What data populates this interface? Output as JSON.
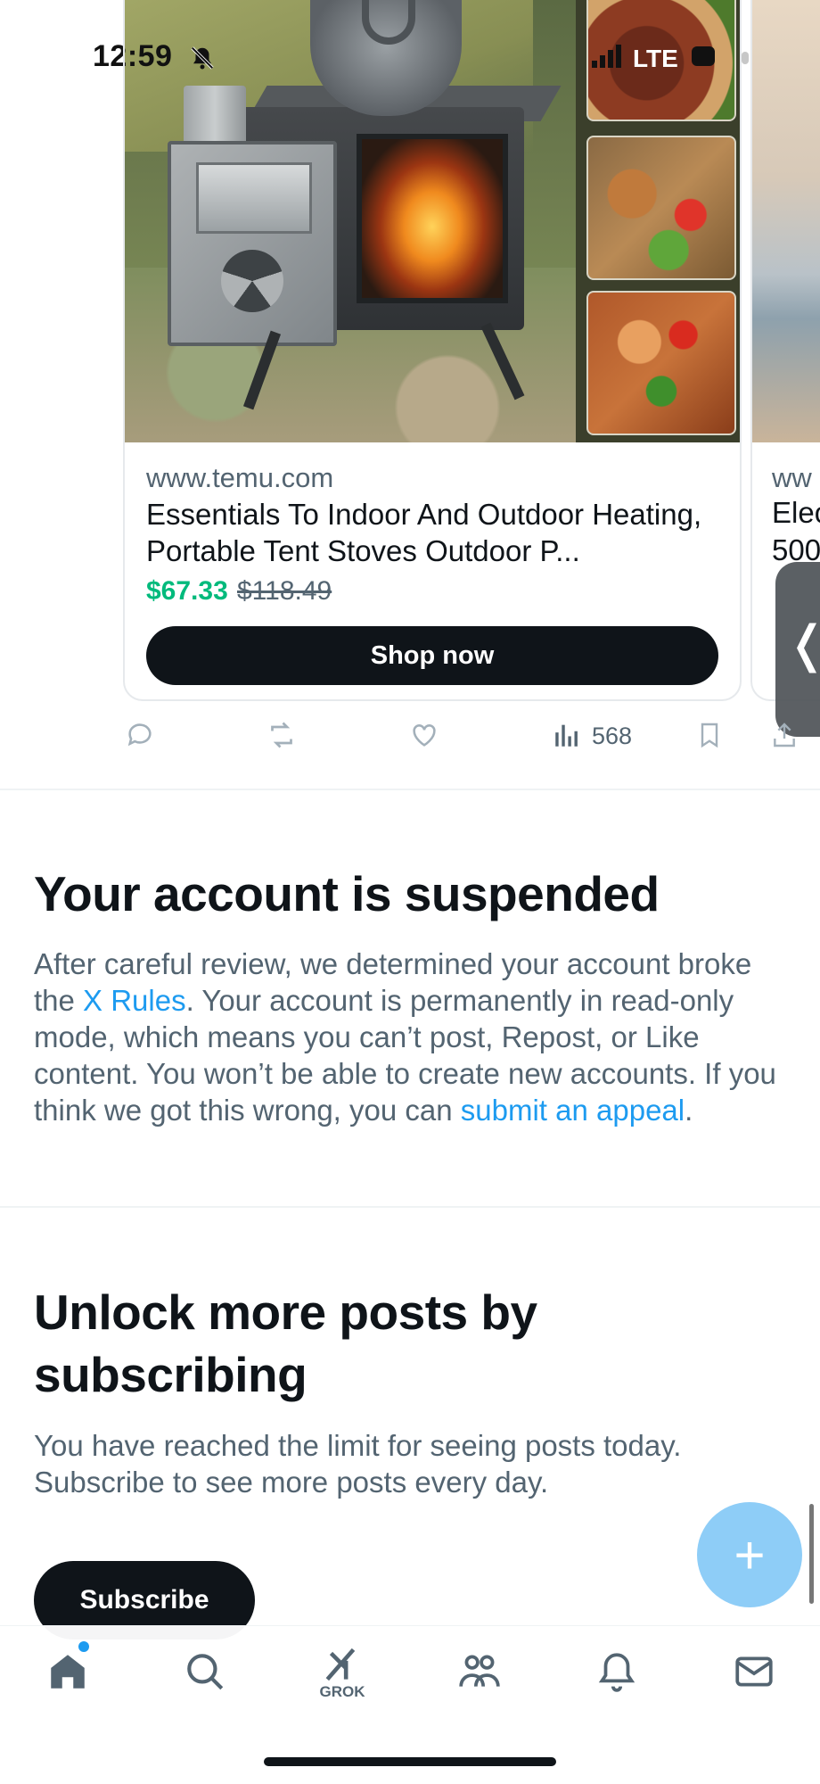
{
  "status_bar": {
    "time": "12:59",
    "network": "LTE"
  },
  "ad_card": {
    "domain": "www.temu.com",
    "title": "Essentials To Indoor And Outdoor Heating, Portable Tent Stoves Outdoor P...",
    "price_now": "$67.33",
    "price_was": "$118.49",
    "cta_label": "Shop now"
  },
  "next_card": {
    "domain_partial": "ww",
    "title_line1_partial": "Elec",
    "title_line2_partial": "500"
  },
  "engagement": {
    "views": "568",
    "icons": [
      "reply-icon",
      "repost-icon",
      "like-icon",
      "views-icon",
      "bookmark-icon",
      "share-icon"
    ]
  },
  "suspended": {
    "heading": "Your account is suspended",
    "text_1": "After careful review, we determined your account broke the ",
    "link_rules": "X Rules",
    "text_2": ". Your account is permanently in read-only mode, which means you can’t post, Repost, or Like content. You won’t be able to create new accounts. If you think we got this wrong, you can ",
    "link_appeal": "submit an appeal",
    "text_3": "."
  },
  "subscribe": {
    "heading": "Unlock more posts by subscribing",
    "text": "You have reached the limit for seeing posts today. Subscribe to see more posts every day.",
    "button_label": "Subscribe"
  },
  "fab": {
    "label": "+"
  },
  "tabbar": {
    "items": [
      {
        "name": "home",
        "icon": "home-icon"
      },
      {
        "name": "search",
        "icon": "search-icon"
      },
      {
        "name": "grok",
        "icon": "grok-icon",
        "label": "GROK"
      },
      {
        "name": "communities",
        "icon": "communities-icon"
      },
      {
        "name": "notifications",
        "icon": "bell-icon"
      },
      {
        "name": "messages",
        "icon": "mail-icon"
      }
    ]
  },
  "colors": {
    "accent": "#1d9bf0",
    "price_green": "#00ba7c",
    "text_primary": "#0f1419",
    "text_secondary": "#536471",
    "fab": "#8ecdf7"
  }
}
